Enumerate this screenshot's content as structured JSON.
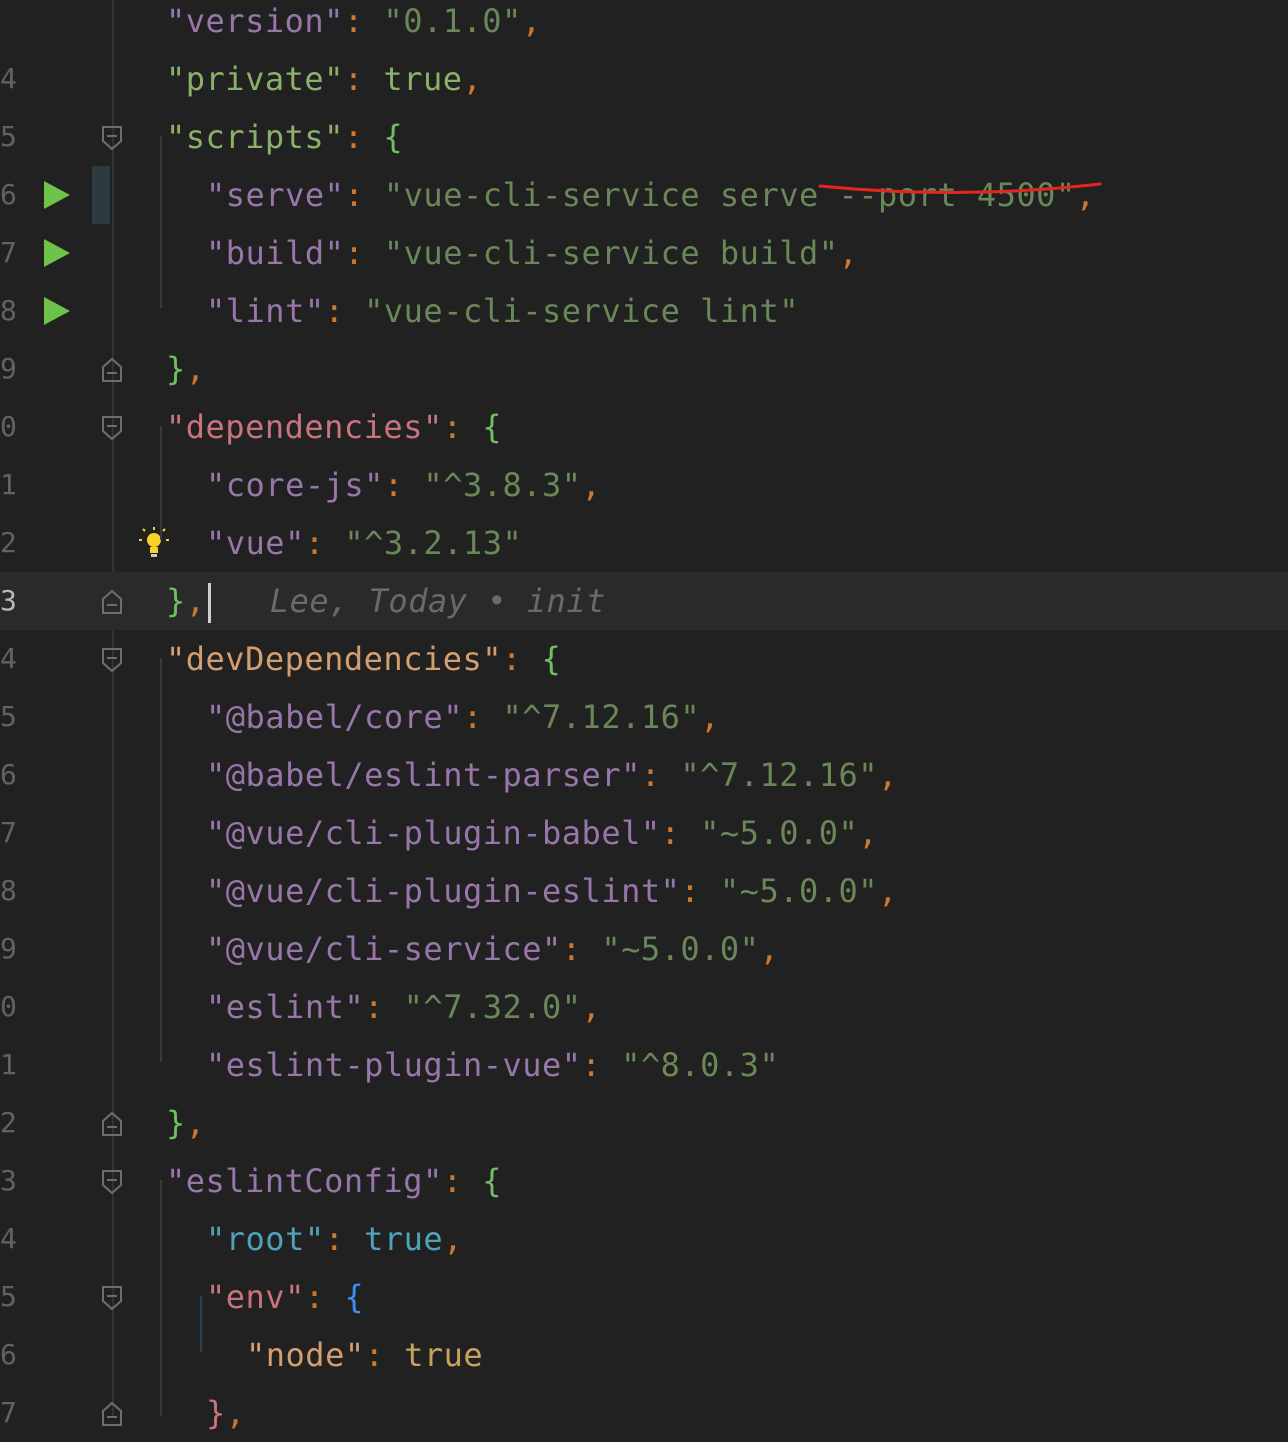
{
  "editor": {
    "gutter_numbers": [
      "",
      "4",
      "5",
      "6",
      "7",
      "8",
      "9",
      "0",
      "1",
      "2",
      "3",
      "4",
      "5",
      "6",
      "7",
      "8",
      "9",
      "0",
      "1",
      "2",
      "3",
      "4",
      "5",
      "6",
      "7"
    ],
    "blame": "Lee, Today • init",
    "lines": [
      {
        "id": "l0",
        "indent": 1,
        "tokens": [
          [
            "\"version\"",
            "k-purple"
          ],
          [
            ": ",
            "colon"
          ],
          [
            "\"0.1.0\"",
            "s-green"
          ],
          [
            ",",
            "comma"
          ]
        ]
      },
      {
        "id": "l1",
        "indent": 1,
        "tokens": [
          [
            "\"private\"",
            "lit-green"
          ],
          [
            ": ",
            "colon"
          ],
          [
            "true",
            "lit-green"
          ],
          [
            ",",
            "comma"
          ]
        ]
      },
      {
        "id": "l2",
        "indent": 1,
        "tokens": [
          [
            "\"scripts\"",
            "lit-green"
          ],
          [
            ": ",
            "colon"
          ],
          [
            "{",
            "b-green"
          ]
        ]
      },
      {
        "id": "l3",
        "indent": 2,
        "tokens": [
          [
            "\"serve\"",
            "k-purple"
          ],
          [
            ": ",
            "colon"
          ],
          [
            "\"vue-cli-service serve --port 4500\"",
            "s-green"
          ],
          [
            ",",
            "comma"
          ]
        ]
      },
      {
        "id": "l4",
        "indent": 2,
        "tokens": [
          [
            "\"build\"",
            "k-purple"
          ],
          [
            ": ",
            "colon"
          ],
          [
            "\"vue-cli-service build\"",
            "s-green"
          ],
          [
            ",",
            "comma"
          ]
        ]
      },
      {
        "id": "l5",
        "indent": 2,
        "tokens": [
          [
            "\"lint\"",
            "k-purple"
          ],
          [
            ": ",
            "colon"
          ],
          [
            "\"vue-cli-service lint\"",
            "s-green"
          ]
        ]
      },
      {
        "id": "l6",
        "indent": 1,
        "tokens": [
          [
            "}",
            "b-green"
          ],
          [
            ",",
            "comma"
          ]
        ]
      },
      {
        "id": "l7",
        "indent": 1,
        "tokens": [
          [
            "\"dependencies\"",
            "k-red"
          ],
          [
            ": ",
            "colon"
          ],
          [
            "{",
            "b-green"
          ]
        ]
      },
      {
        "id": "l8",
        "indent": 2,
        "tokens": [
          [
            "\"core-js\"",
            "k-purple"
          ],
          [
            ": ",
            "colon"
          ],
          [
            "\"^3.8.3\"",
            "s-green"
          ],
          [
            ",",
            "comma"
          ]
        ]
      },
      {
        "id": "l9",
        "indent": 2,
        "tokens": [
          [
            "\"vue\"",
            "k-purple"
          ],
          [
            ": ",
            "colon"
          ],
          [
            "\"^3.2.13\"",
            "s-green"
          ]
        ]
      },
      {
        "id": "l10",
        "indent": 1,
        "tokens": [
          [
            "}",
            "b-green"
          ],
          [
            ",",
            "comma"
          ]
        ]
      },
      {
        "id": "l11",
        "indent": 1,
        "tokens": [
          [
            "\"devDependencies\"",
            "k-orange"
          ],
          [
            ": ",
            "colon"
          ],
          [
            "{",
            "b-green"
          ]
        ]
      },
      {
        "id": "l12",
        "indent": 2,
        "tokens": [
          [
            "\"@babel/core\"",
            "k-purple"
          ],
          [
            ": ",
            "colon"
          ],
          [
            "\"^7.12.16\"",
            "s-green"
          ],
          [
            ",",
            "comma"
          ]
        ]
      },
      {
        "id": "l13",
        "indent": 2,
        "tokens": [
          [
            "\"@babel/eslint-parser\"",
            "k-purple"
          ],
          [
            ": ",
            "colon"
          ],
          [
            "\"^7.12.16\"",
            "s-green"
          ],
          [
            ",",
            "comma"
          ]
        ]
      },
      {
        "id": "l14",
        "indent": 2,
        "tokens": [
          [
            "\"@vue/cli-plugin-babel\"",
            "k-purple"
          ],
          [
            ": ",
            "colon"
          ],
          [
            "\"~5.0.0\"",
            "s-green"
          ],
          [
            ",",
            "comma"
          ]
        ]
      },
      {
        "id": "l15",
        "indent": 2,
        "tokens": [
          [
            "\"@vue/cli-plugin-eslint\"",
            "k-purple"
          ],
          [
            ": ",
            "colon"
          ],
          [
            "\"~5.0.0\"",
            "s-green"
          ],
          [
            ",",
            "comma"
          ]
        ]
      },
      {
        "id": "l16",
        "indent": 2,
        "tokens": [
          [
            "\"@vue/cli-service\"",
            "k-purple"
          ],
          [
            ": ",
            "colon"
          ],
          [
            "\"~5.0.0\"",
            "s-green"
          ],
          [
            ",",
            "comma"
          ]
        ]
      },
      {
        "id": "l17",
        "indent": 2,
        "tokens": [
          [
            "\"eslint\"",
            "k-purple"
          ],
          [
            ": ",
            "colon"
          ],
          [
            "\"^7.32.0\"",
            "s-green"
          ],
          [
            ",",
            "comma"
          ]
        ]
      },
      {
        "id": "l18",
        "indent": 2,
        "tokens": [
          [
            "\"eslint-plugin-vue\"",
            "k-purple"
          ],
          [
            ": ",
            "colon"
          ],
          [
            "\"^8.0.3\"",
            "s-green"
          ]
        ]
      },
      {
        "id": "l19",
        "indent": 1,
        "tokens": [
          [
            "}",
            "b-green"
          ],
          [
            ",",
            "comma"
          ]
        ]
      },
      {
        "id": "l20",
        "indent": 1,
        "tokens": [
          [
            "\"eslintConfig\"",
            "k-purple"
          ],
          [
            ": ",
            "colon"
          ],
          [
            "{",
            "b-green"
          ]
        ]
      },
      {
        "id": "l21",
        "indent": 2,
        "tokens": [
          [
            "\"root\"",
            "k-teal"
          ],
          [
            ": ",
            "colon"
          ],
          [
            "true",
            "lit-teal"
          ],
          [
            ",",
            "comma"
          ]
        ]
      },
      {
        "id": "l22",
        "indent": 2,
        "tokens": [
          [
            "\"env\"",
            "k-red"
          ],
          [
            ": ",
            "colon"
          ],
          [
            "{",
            "b-blue"
          ]
        ]
      },
      {
        "id": "l23",
        "indent": 3,
        "tokens": [
          [
            "\"node\"",
            "k-orange"
          ],
          [
            ": ",
            "colon"
          ],
          [
            "true",
            "lit-gold"
          ]
        ]
      },
      {
        "id": "l24",
        "indent": 2,
        "tokens": [
          [
            "}",
            "b-red"
          ],
          [
            ",",
            "comma"
          ]
        ]
      }
    ],
    "current_line": 10,
    "run_lines": [
      3,
      4,
      5
    ],
    "fold_lines": [
      2,
      6,
      7,
      10,
      11,
      19,
      20,
      22,
      24
    ],
    "bulb_line": 9,
    "colors": {
      "background": "#212121",
      "underline_annotation": "#e5261f",
      "run_icon": "#6cc24a"
    },
    "icons": {
      "run": "run-gutter-icon",
      "fold": "fold-marker-icon",
      "bulb": "intention-bulb-icon"
    }
  }
}
